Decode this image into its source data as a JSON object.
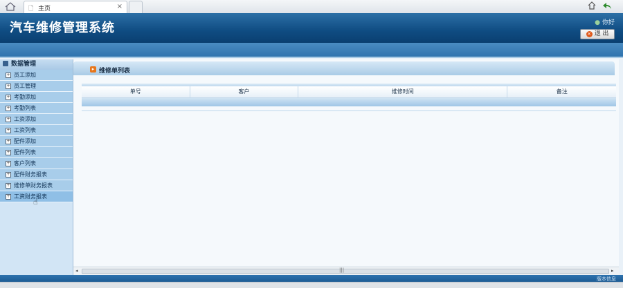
{
  "browser": {
    "tab_title": "主页",
    "close_glyph": "×",
    "doc_glyph": "🗋"
  },
  "header": {
    "app_title": "汽车维修管理系统",
    "greeting": "你好",
    "logout_label": "退 出"
  },
  "sidebar": {
    "section_title": "数据管理",
    "items": [
      {
        "label": "员工添加"
      },
      {
        "label": "员工管理"
      },
      {
        "label": "考勤添加"
      },
      {
        "label": "考勤列表"
      },
      {
        "label": "工资添加"
      },
      {
        "label": "工资列表"
      },
      {
        "label": "配件添加"
      },
      {
        "label": "配件列表"
      },
      {
        "label": "客户列表"
      },
      {
        "label": "配件财务报表"
      },
      {
        "label": "维修单财务报表"
      },
      {
        "label": "工资财务报表"
      }
    ]
  },
  "content": {
    "title": "维修单列表",
    "columns": [
      "单号",
      "客户",
      "维修时间",
      "备注"
    ]
  },
  "footer": {
    "info": "版本信息"
  },
  "icons": {
    "home": "home-icon",
    "doc": "document-icon",
    "close": "close-icon",
    "cube": "cube-icon",
    "expand": "plus-box-icon",
    "cursor": "hand-cursor-icon"
  },
  "colors": {
    "header_dark": "#0f4c82",
    "sidebar_bg": "#d2e5f5",
    "item_bg": "#a8cdea",
    "accent_orange": "#e7761b"
  }
}
